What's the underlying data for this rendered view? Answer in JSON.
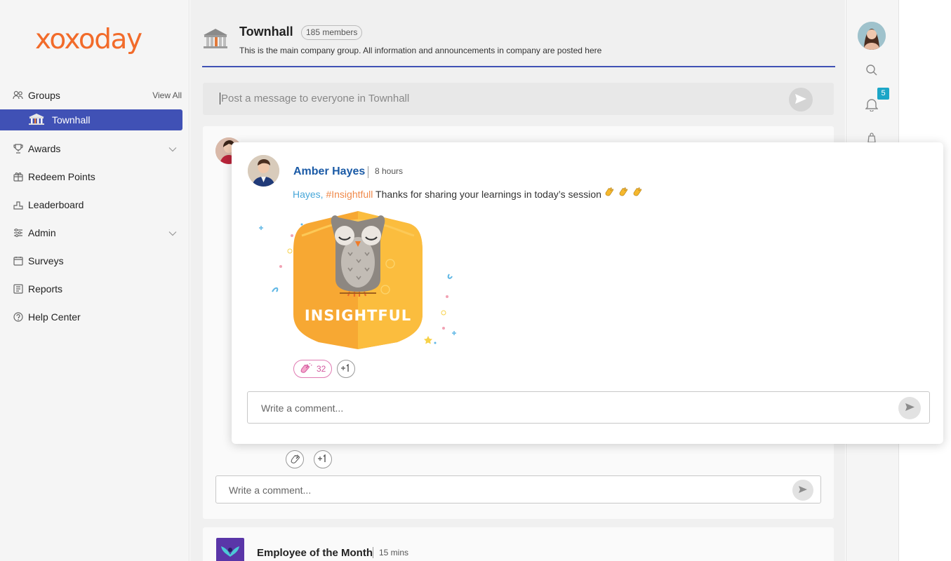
{
  "brand": {
    "logo_text": "xoxoday",
    "color": "#f26b2a"
  },
  "sidebar": {
    "groups_label": "Groups",
    "view_all": "View All",
    "active_group": "Townhall",
    "items": [
      {
        "label": "Awards",
        "icon": "trophy-icon",
        "expandable": true
      },
      {
        "label": "Redeem Points",
        "icon": "gift-icon",
        "expandable": false
      },
      {
        "label": "Leaderboard",
        "icon": "podium-icon",
        "expandable": false
      },
      {
        "label": "Admin",
        "icon": "sliders-icon",
        "expandable": true
      },
      {
        "label": "Surveys",
        "icon": "survey-icon",
        "expandable": false
      },
      {
        "label": "Reports",
        "icon": "report-icon",
        "expandable": false
      },
      {
        "label": "Help Center",
        "icon": "help-icon",
        "expandable": false
      }
    ],
    "active_color": "#4051b5"
  },
  "group_header": {
    "title": "Townhall",
    "members": "185 members",
    "description": "This is the main company group. All information and announcements in company are posted here"
  },
  "composer": {
    "placeholder": "Post a message to everyone in Townhall"
  },
  "feed": {
    "comment_placeholder": "Write a comment...",
    "next_post": {
      "title": "Employee of the Month",
      "time": "15 mins"
    }
  },
  "popup": {
    "author": "Amber Hayes",
    "time": "8 hours",
    "mention": "Hayes,",
    "hashtag": "#Insightfull",
    "message": "Thanks for sharing your learnings in today’s session",
    "badge_label": "INSIGHTFUL",
    "clap_count": "32",
    "comment_placeholder": "Write a comment..."
  },
  "rail": {
    "notification_count": "5"
  }
}
